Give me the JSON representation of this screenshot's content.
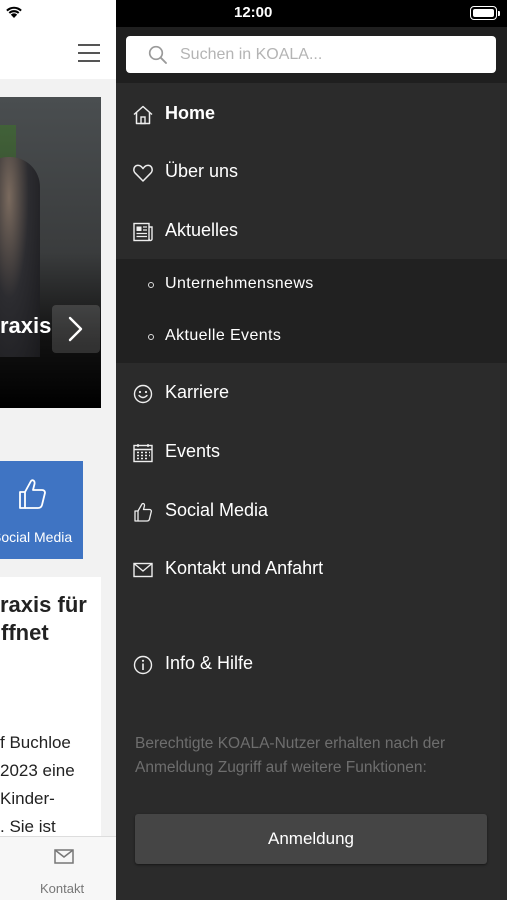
{
  "status_bar": {
    "time": "12:00"
  },
  "background_app": {
    "hero": {
      "title": "raxis"
    },
    "tiles": [
      {
        "label": "Social Media",
        "icon": "thumbs-up-icon"
      }
    ],
    "article": {
      "title_lines": [
        "raxis für",
        "ffnet"
      ],
      "body_lines": [
        "f Buchloe",
        "2023 eine",
        "Kinder-",
        ". Sie ist"
      ]
    },
    "tabbar": {
      "contact_label": "Kontakt",
      "contact_icon": "mail-icon"
    }
  },
  "drawer": {
    "search": {
      "placeholder": "Suchen in KOALA..."
    },
    "menu": [
      {
        "label": "Home",
        "icon": "home-icon",
        "active": true
      },
      {
        "label": "Über uns",
        "icon": "heart-icon"
      },
      {
        "label": "Aktuelles",
        "icon": "newspaper-icon",
        "expanded": true,
        "children": [
          {
            "label": "Unternehmensnews"
          },
          {
            "label": "Aktuelle Events"
          }
        ]
      },
      {
        "label": "Karriere",
        "icon": "smiley-icon"
      },
      {
        "label": "Events",
        "icon": "calendar-icon"
      },
      {
        "label": "Social Media",
        "icon": "thumbs-up-icon"
      },
      {
        "label": "Kontakt und Anfahrt",
        "icon": "mail-icon"
      },
      {
        "label": "Info & Hilfe",
        "icon": "info-icon"
      }
    ],
    "info_text": "Berechtigte KOALA-Nutzer erhalten nach der Anmeldung Zugriff auf weitere Funktionen:",
    "login_label": "Anmeldung"
  },
  "colors": {
    "drawer_bg": "#2b2b2b",
    "submenu_bg": "#212121",
    "tile_blue": "#3f74c3",
    "login_bg": "#454545"
  }
}
